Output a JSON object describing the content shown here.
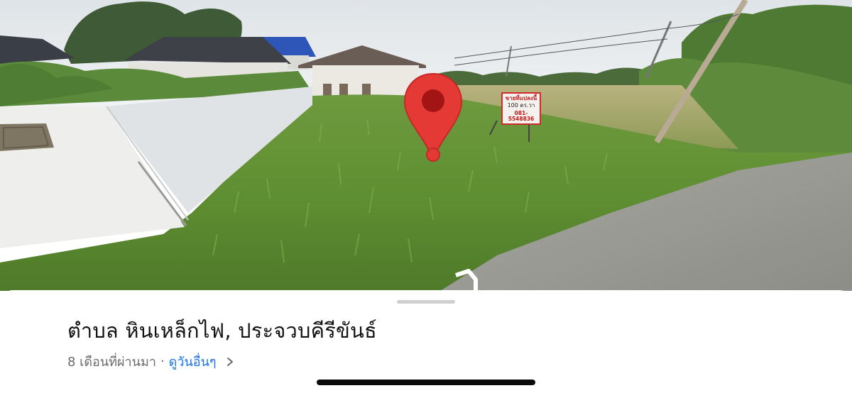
{
  "street_view": {
    "sign": {
      "line1": "ขายที่แปลงนี้",
      "line2": "100 ตร.วา",
      "line3": "081-5548836"
    },
    "icons": [
      "location-pin-icon",
      "navigation-arrow-icon"
    ]
  },
  "sheet": {
    "title": "ตำบล หินเหล็กไฟ, ประจวบคีรีขันธ์",
    "date_text": "8 เดือนที่ผ่านมา",
    "separator": "·",
    "more_link": "ดูวันอื่นๆ"
  },
  "colors": {
    "pin": "#e53935",
    "link": "#1a73e8"
  }
}
